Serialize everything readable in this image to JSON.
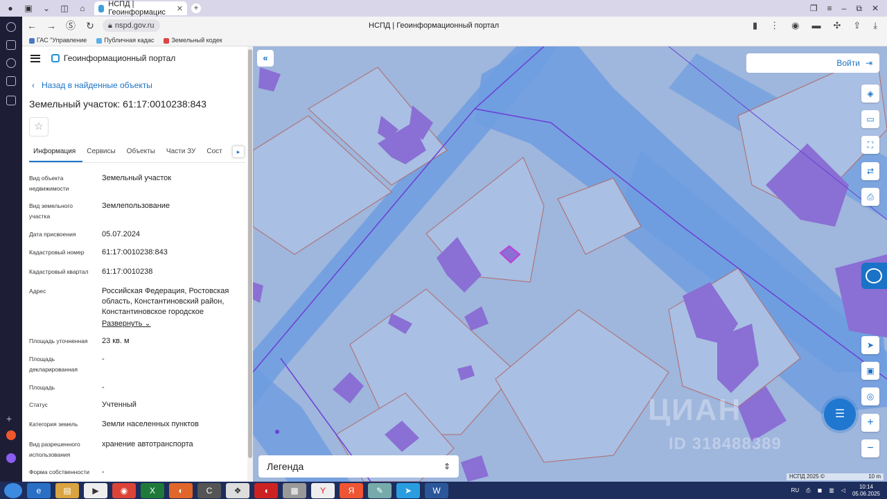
{
  "browser": {
    "tab_title": "НСПД | Геоинформацис",
    "url": "nspd.gov.ru",
    "page_title": "НСПД | Геоинформационный портал",
    "bookmarks": [
      "ГАС \"Управление",
      "Публичная кадас",
      "Земельный кодек"
    ]
  },
  "panel": {
    "portal_name": "Геоинформационный портал",
    "back_link": "Назад в найденные объекты",
    "title": "Земельный участок: 61:17:0010238:843",
    "tabs": [
      "Информация",
      "Сервисы",
      "Объекты",
      "Части ЗУ",
      "Сост"
    ],
    "properties": [
      {
        "key": "Вид объекта недвижимости",
        "value": "Земельный участок"
      },
      {
        "key": "Вид земельного участка",
        "value": "Землепользование"
      },
      {
        "key": "Дата присвоения",
        "value": "05.07.2024"
      },
      {
        "key": "Кадастровый номер",
        "value": "61:17:0010238:843"
      },
      {
        "key": "Кадастровый квартал",
        "value": "61:17:0010238"
      },
      {
        "key": "Адрес",
        "value": "Российская Федерация, Ростовская область, Константиновский район, Константиновское городское"
      },
      {
        "key": "Площадь уточненная",
        "value": "23 кв. м"
      },
      {
        "key": "Площадь декларированная",
        "value": "-"
      },
      {
        "key": "Площадь",
        "value": "-"
      },
      {
        "key": "Статус",
        "value": "Учтенный"
      },
      {
        "key": "Категория земель",
        "value": "Земли населенных пунктов"
      },
      {
        "key": "Вид разрешенного использования",
        "value": "хранение автотранспорта"
      },
      {
        "key": "Форма собственности",
        "value": "-"
      }
    ],
    "expand_label": "Развернуть"
  },
  "map": {
    "login_label": "Войти",
    "legend_label": "Легенда",
    "copyright": "НСПД 2025 ©",
    "scale_label": "10 m",
    "watermark": "ЦИАН",
    "watermark_id": "ID 318488389",
    "colors": {
      "base": "#9fb6dd",
      "road": "#6e9ee0",
      "building": "#8a6fd4",
      "parcel_line": "#b06a6a"
    }
  },
  "taskbar": {
    "lang": "RU",
    "time": "10:14",
    "date": "05.06.2025"
  }
}
